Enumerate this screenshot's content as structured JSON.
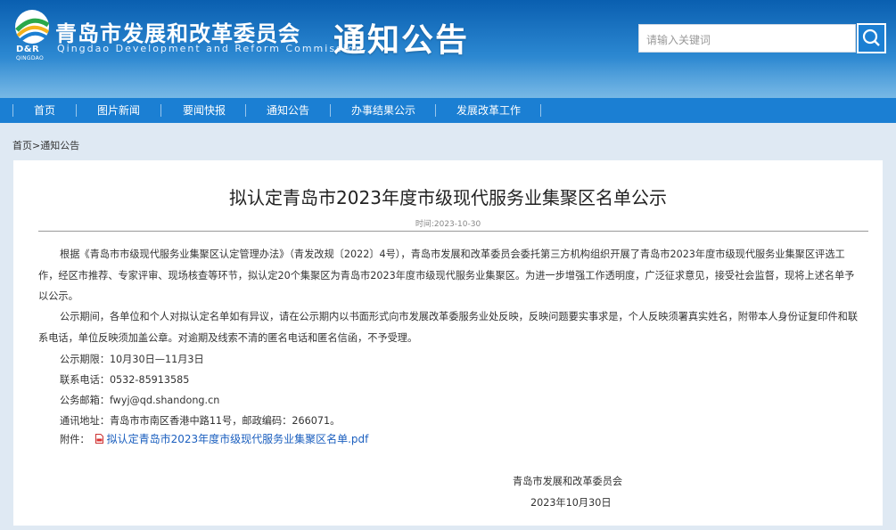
{
  "header": {
    "logo_abbr": "D&R",
    "logo_sub": "QINGDAO",
    "org_name_cn": "青岛市发展和改革委员会",
    "org_name_en": "Qingdao Development and Reform Commission",
    "section_title": "通知公告",
    "search_placeholder": "请输入关键词",
    "search_icon": "search-icon"
  },
  "nav": {
    "items": [
      "首页",
      "图片新闻",
      "要闻快报",
      "通知公告",
      "办事结果公示",
      "发展改革工作"
    ]
  },
  "breadcrumb": {
    "home": "首页",
    "sep": ">",
    "current": "通知公告"
  },
  "article": {
    "title": "拟认定青岛市2023年度市级现代服务业集聚区名单公示",
    "date": "时间:2023-10-30",
    "para1": "根据《青岛市市级现代服务业集聚区认定管理办法》（青发改规〔2022〕4号），青岛市发展和改革委员会委托第三方机构组织开展了青岛市2023年度市级现代服务业集聚区评选工作，经区市推荐、专家评审、现场核查等环节，拟认定20个集聚区为青岛市2023年度市级现代服务业集聚区。为进一步增强工作透明度，广泛征求意见，接受社会监督，现将上述名单予以公示。",
    "para2": "公示期间，各单位和个人对拟认定名单如有异议，请在公示期内以书面形式向市发展改革委服务业处反映，反映问题要实事求是，个人反映须署真实姓名，附带本人身份证复印件和联系电话，单位反映须加盖公章。对逾期及线索不清的匿名电话和匿名信函，不予受理。",
    "period": "公示期限：10月30日—11月3日",
    "phone": "联系电话：0532-85913585",
    "email": "公务邮箱：fwyj@qd.shandong.cn",
    "address": "通讯地址：青岛市市南区香港中路11号，邮政编码：266071。",
    "attach_label": "附件：",
    "attach_icon": "pdf-icon",
    "attach_link": "拟认定青岛市2023年度市级现代服务业集聚区名单.pdf",
    "signer": "青岛市发展和改革委员会",
    "sign_date": "2023年10月30日"
  },
  "colors": {
    "nav_bg": "#1b7fd3",
    "link": "#1b5fbf"
  }
}
